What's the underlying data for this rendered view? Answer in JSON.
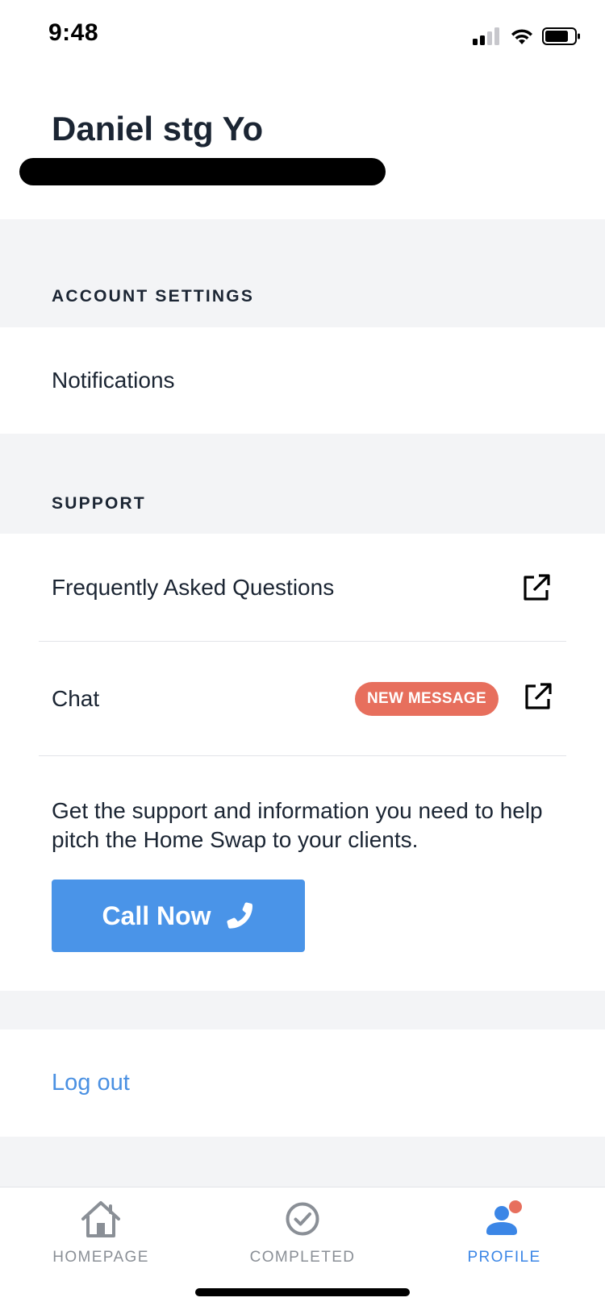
{
  "status_bar": {
    "time": "9:48"
  },
  "header": {
    "user_name": "Daniel stg Yo"
  },
  "account_settings": {
    "section_label": "ACCOUNT SETTINGS",
    "items": [
      {
        "label": "Notifications"
      }
    ]
  },
  "support": {
    "section_label": "SUPPORT",
    "faq_label": "Frequently Asked Questions",
    "chat_label": "Chat",
    "chat_badge": "NEW MESSAGE",
    "description": "Get the support and information you need to help pitch the Home Swap to your clients.",
    "call_button_label": "Call Now"
  },
  "logout_label": "Log out",
  "tabs": [
    {
      "label": "HOMEPAGE",
      "icon": "home-icon",
      "active": false
    },
    {
      "label": "COMPLETED",
      "icon": "check-circle-icon",
      "active": false
    },
    {
      "label": "PROFILE",
      "icon": "profile-icon",
      "active": true
    }
  ],
  "colors": {
    "accent_blue": "#4a94e8",
    "badge_red": "#e76f5d",
    "section_bg": "#f3f4f6",
    "text_dark": "#1b2533",
    "tab_inactive": "#8a8f96"
  }
}
